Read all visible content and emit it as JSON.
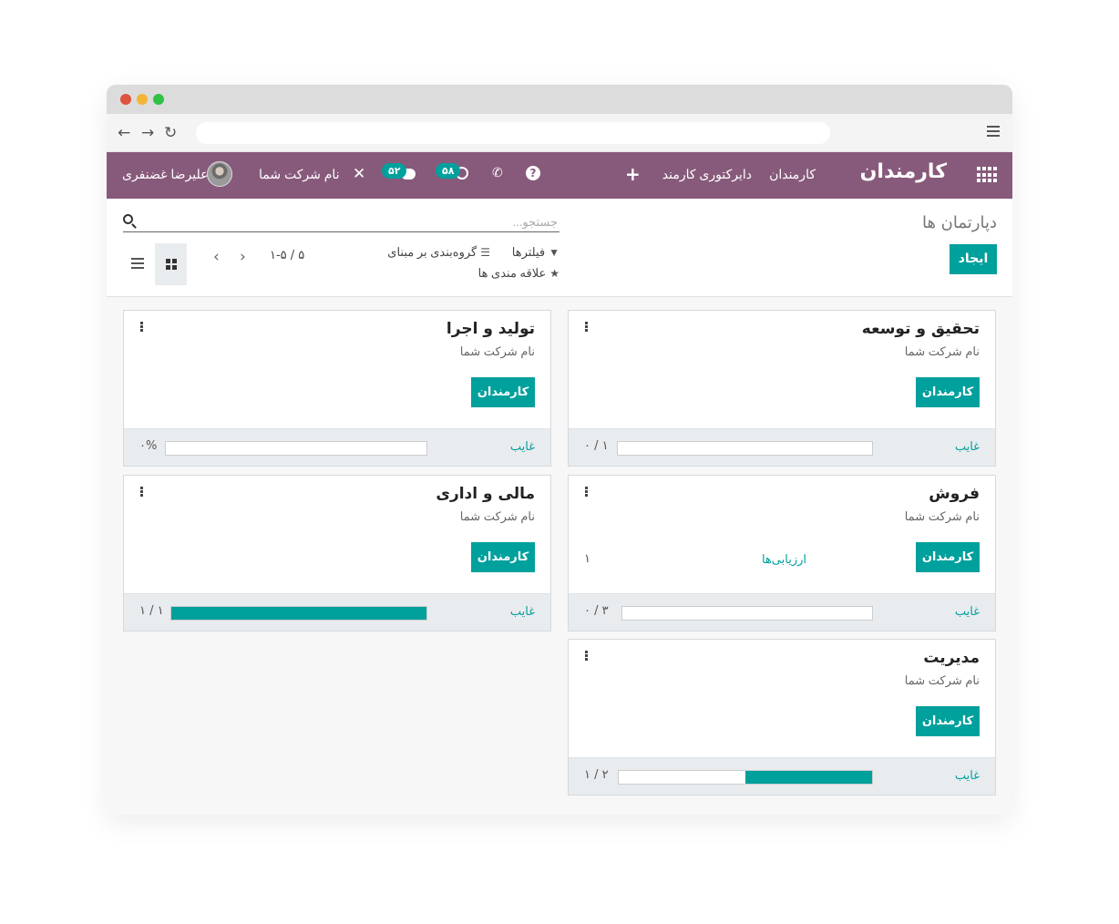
{
  "app": {
    "brand": "کارمندان",
    "menu": {
      "employees": "کارمندان",
      "directory": "دایرکتوری کارمند"
    },
    "badges": {
      "activities": "۵۸",
      "messages": "۵۲"
    },
    "company": "نام شرکت شما",
    "user": "علیرضا غضنفری"
  },
  "control": {
    "breadcrumb": "دپارتمان ها",
    "create_label": "ایجاد",
    "search_placeholder": "جستجو...",
    "filters_label": "فیلترها",
    "groupby_label": "گروه‌بندی بر مبنای",
    "favorites_label": "علاقه مندی ها",
    "pager": "۱-۵ / ۵"
  },
  "cards": [
    {
      "name": "تحقیق و توسعه",
      "company": "نام شرکت شما",
      "button": "کارمندان",
      "absent_label": "غایب",
      "ratio": "۰ / ۱",
      "fill": 0
    },
    {
      "name": "تولید و اجرا",
      "company": "نام شرکت شما",
      "button": "کارمندان",
      "absent_label": "غایب",
      "ratio": "۰%",
      "fill": 0
    },
    {
      "name": "فروش",
      "company": "نام شرکت شما",
      "button": "کارمندان",
      "eval_label": "ارزیابی‌ها",
      "eval_count": "۱",
      "absent_label": "غایب",
      "ratio": "۰ / ۳",
      "fill": 0
    },
    {
      "name": "مالی و اداری",
      "company": "نام شرکت شما",
      "button": "کارمندان",
      "absent_label": "غایب",
      "ratio": "۱ / ۱",
      "fill": 1
    },
    {
      "name": "مدیریت",
      "company": "نام شرکت شما",
      "button": "کارمندان",
      "absent_label": "غایب",
      "ratio": "۱ / ۲",
      "fill": 0.5
    }
  ]
}
